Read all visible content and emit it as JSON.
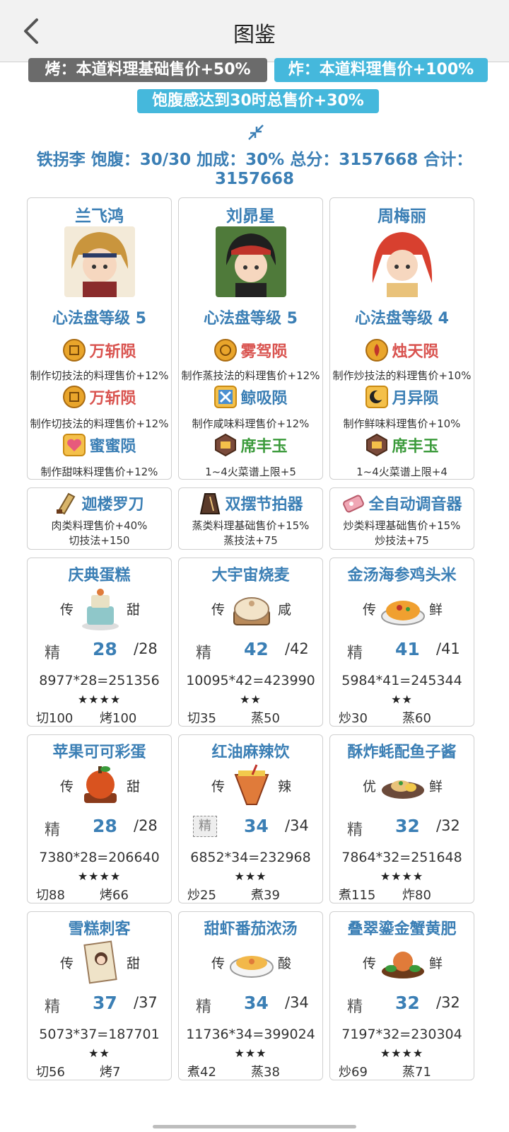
{
  "header": {
    "title": "图鉴",
    "back_icon": "chevron-left-icon"
  },
  "bonuses": [
    "烤：本道料理基础售价+50%",
    "炸：本道料理售价+100%",
    "饱腹感达到30时总售价+30%"
  ],
  "summary": {
    "line1": "铁拐李 饱腹：30/30 加成：30% 总分：3157668 合计：",
    "line2": "3157668"
  },
  "chefs": [
    {
      "name": "兰飞鸿",
      "level": "心法盘等级 5",
      "skills": [
        {
          "name": "万斩陨",
          "desc": "制作切技法的料理售价+12%",
          "color": "red",
          "icon": "coin-icon"
        },
        {
          "name": "万斩陨",
          "desc": "制作切技法的料理售价+12%",
          "color": "red",
          "icon": "coin-icon"
        },
        {
          "name": "蜜蜜陨",
          "desc": "制作甜味料理售价+12%",
          "color": "blue",
          "icon": "heart-icon"
        }
      ]
    },
    {
      "name": "刘昴星",
      "level": "心法盘等级 5",
      "skills": [
        {
          "name": "雾驾陨",
          "desc": "制作蒸技法的料理售价+12%",
          "color": "red",
          "icon": "coin-icon"
        },
        {
          "name": "鲸吸陨",
          "desc": "制作咸味料理售价+12%",
          "color": "blue",
          "icon": "cross-icon"
        },
        {
          "name": "席丰玉",
          "desc": "1~4火菜谱上限+5",
          "color": "green",
          "icon": "gem-icon"
        }
      ]
    },
    {
      "name": "周梅丽",
      "level": "心法盘等级 4",
      "skills": [
        {
          "name": "烛天陨",
          "desc": "制作炒技法的料理售价+10%",
          "color": "red",
          "icon": "flame-coin-icon"
        },
        {
          "name": "月异陨",
          "desc": "制作鲜味料理售价+10%",
          "color": "blue",
          "icon": "crescent-icon"
        },
        {
          "name": "席丰玉",
          "desc": "1~4火菜谱上限+4",
          "color": "green",
          "icon": "gem-icon"
        }
      ]
    }
  ],
  "equipment": [
    {
      "name": "迦楼罗刀",
      "line1": "肉类料理售价+40%",
      "line2": "切技法+150",
      "icon": "cleaver-icon"
    },
    {
      "name": "双摆节拍器",
      "line1": "蒸类料理基础售价+15%",
      "line2": "蒸技法+75",
      "icon": "metronome-icon"
    },
    {
      "name": "全自动调音器",
      "line1": "炒类料理基础售价+15%",
      "line2": "炒技法+75",
      "icon": "tuner-icon"
    }
  ],
  "dishes": [
    {
      "name": "庆典蛋糕",
      "rarity": "传",
      "flavor": "甜",
      "quality": "精",
      "count": "28",
      "max": "/28",
      "calc": "8977*28=251356",
      "stars": "★★★★",
      "skill1": "切100",
      "skill2": "烤100",
      "icon": "cake-icon"
    },
    {
      "name": "大宇宙烧麦",
      "rarity": "传",
      "flavor": "咸",
      "quality": "精",
      "count": "42",
      "max": "/42",
      "calc": "10095*42=423990",
      "stars": "★★",
      "skill1": "切35",
      "skill2": "蒸50",
      "icon": "dumpling-icon"
    },
    {
      "name": "金汤海参鸡头米",
      "rarity": "传",
      "flavor": "鲜",
      "quality": "精",
      "count": "41",
      "max": "/41",
      "calc": "5984*41=245344",
      "stars": "★★",
      "skill1": "炒30",
      "skill2": "蒸60",
      "icon": "soup-bowl-icon"
    },
    {
      "name": "苹果可可彩蛋",
      "rarity": "传",
      "flavor": "甜",
      "quality": "精",
      "count": "28",
      "max": "/28",
      "calc": "7380*28=206640",
      "stars": "★★★★",
      "skill1": "切88",
      "skill2": "烤66",
      "icon": "apple-egg-icon"
    },
    {
      "name": "红油麻辣饮",
      "rarity": "传",
      "flavor": "辣",
      "quality": "精",
      "count": "34",
      "max": "/34",
      "calc": "6852*34=232968",
      "stars": "★★★",
      "skill1": "炒25",
      "skill2": "煮39",
      "icon": "drink-icon",
      "quality_boxed": true
    },
    {
      "name": "酥炸蚝配鱼子酱",
      "rarity": "优",
      "flavor": "鲜",
      "quality": "精",
      "count": "32",
      "max": "/32",
      "calc": "7864*32=251648",
      "stars": "★★★★",
      "skill1": "煮115",
      "skill2": "炸80",
      "icon": "oyster-icon"
    },
    {
      "name": "雪糕刺客",
      "rarity": "传",
      "flavor": "甜",
      "quality": "精",
      "count": "37",
      "max": "/37",
      "calc": "5073*37=187701",
      "stars": "★★",
      "skill1": "切56",
      "skill2": "烤7",
      "icon": "icecream-scroll-icon"
    },
    {
      "name": "甜虾番茄浓汤",
      "rarity": "传",
      "flavor": "酸",
      "quality": "精",
      "count": "34",
      "max": "/34",
      "calc": "11736*34=399024",
      "stars": "★★★",
      "skill1": "煮42",
      "skill2": "蒸38",
      "icon": "soup-icon"
    },
    {
      "name": "叠翠鎏金蟹黄肥",
      "rarity": "传",
      "flavor": "鲜",
      "quality": "精",
      "count": "32",
      "max": "/32",
      "calc": "7197*32=230304",
      "stars": "★★★★",
      "skill1": "炒69",
      "skill2": "蒸71",
      "icon": "crab-dish-icon"
    }
  ]
}
